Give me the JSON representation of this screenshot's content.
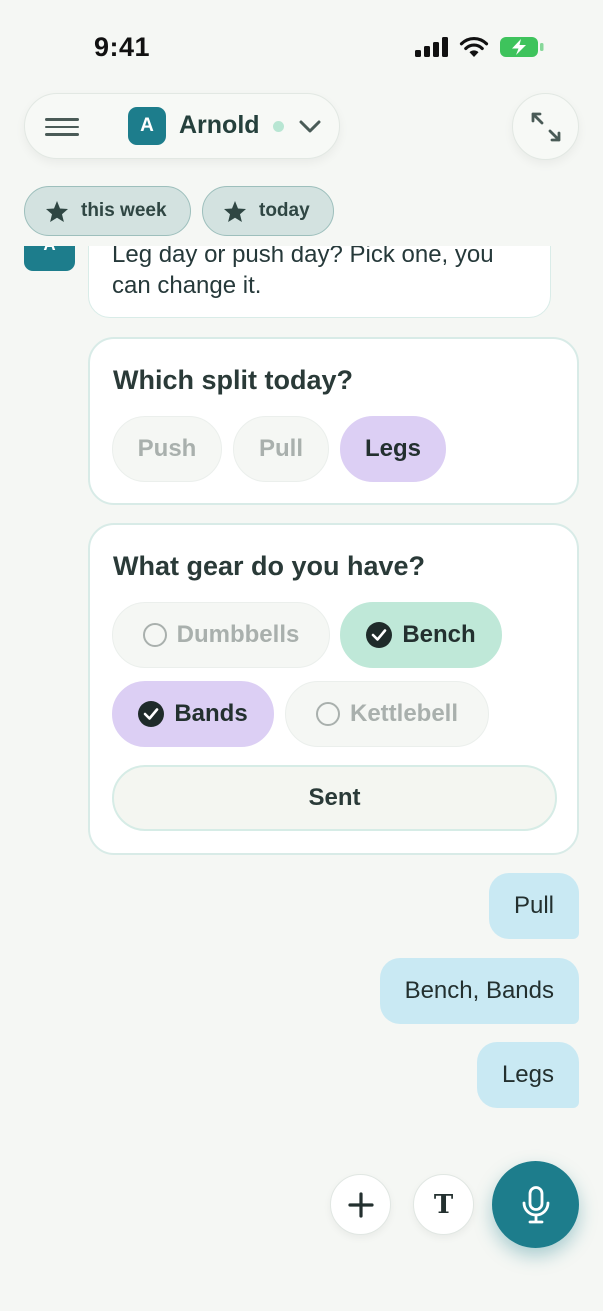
{
  "status_bar": {
    "time": "9:41"
  },
  "header": {
    "agent_initial": "A",
    "agent_name": "Arnold",
    "icons": [
      "menu-icon",
      "chevron-down-icon",
      "expand-icon"
    ]
  },
  "chips": [
    {
      "label": "this week",
      "icon": "star-icon"
    },
    {
      "label": "today",
      "icon": "star-icon"
    }
  ],
  "chat": {
    "bot_initial": "A",
    "bot_message": "Leg day or push day? Pick one, you can change it.",
    "split_card": {
      "title": "Which split today?",
      "options": [
        {
          "label": "Push",
          "selected": false
        },
        {
          "label": "Pull",
          "selected": false
        },
        {
          "label": "Legs",
          "selected": true
        }
      ]
    },
    "gear_card": {
      "title": "What gear do you have?",
      "options": [
        {
          "label": "Dumbbells",
          "checked": false
        },
        {
          "label": "Bench",
          "checked": true
        },
        {
          "label": "Bands",
          "checked": true
        },
        {
          "label": "Kettlebell",
          "checked": false
        }
      ],
      "submit_label": "Sent"
    },
    "user_messages": [
      "Pull",
      "Bench, Bands",
      "Legs"
    ]
  },
  "composer": {
    "add_glyph": "+",
    "text_glyph": "T",
    "icons": [
      "plus-icon",
      "text-format-icon",
      "microphone-icon"
    ]
  },
  "colors": {
    "accent": "#1d7d8c",
    "background": "#f5f7f4",
    "selected_purple": "#dccff4",
    "selected_green": "#bfe8d8",
    "user_bubble": "#c9e9f3"
  }
}
